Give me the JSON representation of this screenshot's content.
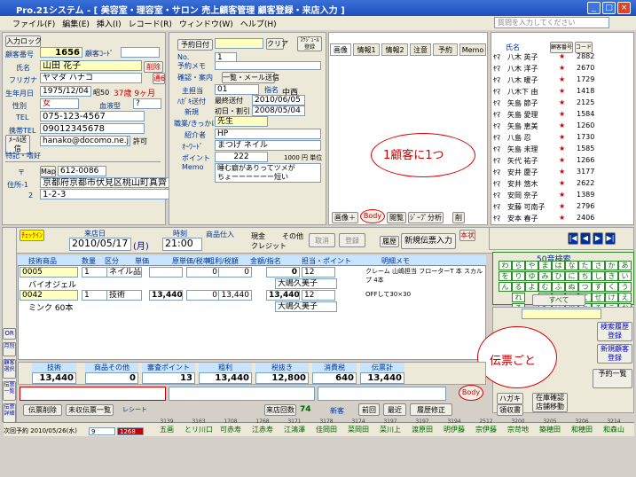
{
  "window": {
    "title": "Pro.21システム - [ 美容室・理容室・サロン 売上顧客管理 顧客登録・来店入力 ]",
    "help_placeholder": "質問を入力してください"
  },
  "menu": [
    "ファイル(F)",
    "編集(E)",
    "挿入(I)",
    "レコード(R)",
    "ウィンドウ(W)",
    "ヘルプ(H)"
  ],
  "customer": {
    "input_lock": "入力ロック",
    "no_label": "顧客番号",
    "no": "1656",
    "code_label": "顧客ｺｰﾄﾞ",
    "name_label": "氏名",
    "name": "山田 花子",
    "delete": "削除",
    "furigana_label": "フリガナ",
    "furigana": "ヤマダ ハナコ",
    "tsu": "通6",
    "birth_label": "生年月日",
    "birth": "1975/12/04",
    "era": "昭50",
    "age": "37",
    "age_unit": "歳",
    "months": "9",
    "month_unit": "ヶ月",
    "sex_label": "性別",
    "sex": "女",
    "blood_label": "血液型",
    "blood": "?",
    "tel_label": "TEL",
    "tel": "075-123-4567",
    "mobile_label": "携帯TEL",
    "mobile": "09012345678",
    "mail_btn": "ﾒｰﾙ送信",
    "mail": "hanako@docomo.ne.jp",
    "permit": "許可",
    "feature_label": "特記・嗜好",
    "zip_label": "〒",
    "map": "Map",
    "zip": "612-0086",
    "addr_label": "住所-1",
    "addr1": "京都府京都市伏見区桃山町真齊",
    "addr2_label": "2",
    "addr2": "1-2-3"
  },
  "middle": {
    "yoyaku": "予約日付",
    "clip": "クリア",
    "schedule": "ｽｹｼﾞｭｰﾙ登録",
    "no_label": "No.",
    "no": "1",
    "memo_label": "予約メモ",
    "mail_send": "一覧・メール送信",
    "confirm_label": "確認・案内",
    "staff_label": "主担当",
    "staff": "01",
    "shimei": "指名",
    "chuuken": "中西",
    "hagaki_label": "ﾊｶﾞｷ送付",
    "hagaki_check": "最終送付",
    "hagaki_date": "2010/06/05",
    "new_label": "新規",
    "first_label": "初日・割引",
    "first_date": "2008/05/04",
    "job_label": "職業/きっかけ",
    "job": "先生",
    "intro_label": "紹介者",
    "intro": "HP",
    "word_label": "ｵｰﾜｰﾄﾞ",
    "word": "まつげ ネイル",
    "point_label": "ポイント",
    "point": "222",
    "point_unit": "1000 円 単位",
    "memo2_label": "Memo",
    "memo2": "睡む癖がありってツメが\nちょーーーーーー短い"
  },
  "tabs": [
    "画像",
    "情報1",
    "情報2",
    "注意",
    "予約",
    "Memo"
  ],
  "image_btns": [
    "画像＋",
    "Body",
    "閲覧",
    "ｼﾞｰﾌﾟ分析",
    "削"
  ],
  "annotation1": "1顧客に1つ",
  "annotation2": "伝票ごと",
  "customer_list": {
    "header": [
      "氏名",
      "顧客番号",
      "コード"
    ],
    "rows": [
      [
        "ﾔﾏ",
        "八木 英子",
        "2882"
      ],
      [
        "ﾔﾏ",
        "八木 洋子",
        "2670"
      ],
      [
        "ﾔﾏ",
        "八木 暖子",
        "1729"
      ],
      [
        "ﾔﾏ",
        "八木下 由",
        "1418"
      ],
      [
        "ﾔﾏ",
        "矢島 節子",
        "2125"
      ],
      [
        "ﾔﾏ",
        "矢島 愛理",
        "1584"
      ],
      [
        "ﾔﾏ",
        "矢島 恵美",
        "1260"
      ],
      [
        "ﾔﾏ",
        "八島 忍",
        "1730"
      ],
      [
        "ﾔﾏ",
        "矢島 未理",
        "1585"
      ],
      [
        "ﾔﾏ",
        "矢代 祐子",
        "1266"
      ],
      [
        "ﾔﾏ",
        "安井 慶子",
        "3177"
      ],
      [
        "ﾔﾏ",
        "安井 悠木",
        "2622"
      ],
      [
        "ﾔﾏ",
        "安岡 奈子",
        "1389"
      ],
      [
        "ﾔﾏ",
        "安藤 可南子",
        "2796"
      ],
      [
        "ﾔﾏ",
        "安本 春子",
        "2406"
      ]
    ]
  },
  "visit": {
    "label": "ﾁｪｯｸｲﾝ",
    "date_label": "来店日",
    "date": "2010/05/17",
    "dow": "(月)",
    "time_label": "時刻",
    "time": "21:00",
    "goods_label": "商品仕入",
    "pay_cash": "現金",
    "pay_credit": "クレジット",
    "pay_other": "その他",
    "cancel": "取消",
    "register": "登録",
    "history": "履歴",
    "new_slip": "新規伝票入力",
    "lock": "本状"
  },
  "grid_header": [
    "技術商品",
    "数量",
    "区分",
    "単価",
    "原単価/税率",
    "粗利/税額",
    "金額/指名",
    "担当・ポイント",
    "明細メモ"
  ],
  "grid_rows": [
    {
      "code": "0005",
      "qty": "1",
      "kind": "ネイル品",
      "price": "",
      "cost": "0",
      "profit": "0",
      "amount": "0",
      "pt": "12",
      "memo": "クレーム 山嶋担当 フローターT 本 スカルプ 4本",
      "name": "バイオジェル",
      "staff": "大嶋久美子"
    },
    {
      "code": "0042",
      "qty": "1",
      "kind": "技術",
      "price": "13,440",
      "cost": "0",
      "profit": "13,440",
      "amount": "13,440",
      "pt": "12",
      "memo": "OFFして30×30",
      "name": "ミンク 60本",
      "staff": "大嶋久美子"
    }
  ],
  "totals": {
    "tech_label": "技術",
    "tech": "13,440",
    "goods_label": "商品その他",
    "goods": "0",
    "point_label": "審査ポイント",
    "point": "13",
    "arari_label": "粗利",
    "arari": "13,440",
    "tax_ex_label": "税抜き",
    "tax_ex": "12,800",
    "tax_label": "消費税",
    "tax": "640",
    "total_label": "伝票計",
    "total": "13,440"
  },
  "bottom": {
    "slip_delete": "伝票削除",
    "slip_list": "未収伝票一覧",
    "receipt": "レシート",
    "visits_label": "来店回数",
    "visits": "74",
    "new_label": "新客",
    "prev": "前回",
    "latest": "最近",
    "history_edit": "履歴修正",
    "next_visit": "次回予約 2010/05/26(水)",
    "cycle": "9",
    "total_sales": "1268"
  },
  "bottom_staff": [
    [
      "3139",
      "五画"
    ],
    [
      "3163",
      "とリ川口"
    ],
    [
      "1708",
      "可赤寿"
    ],
    [
      "1768",
      "江赤寿"
    ],
    [
      "3171",
      "江鴻澤"
    ],
    [
      "3178",
      "佳岡田"
    ],
    [
      "3174",
      "菜岡田"
    ],
    [
      "3197",
      "菜川上"
    ],
    [
      "3197",
      "渡原田"
    ],
    [
      "3194",
      "明伊藤"
    ],
    [
      "2512",
      "宗伊藤"
    ],
    [
      "3200",
      "宗苛地"
    ],
    [
      "3205",
      "築穂田"
    ],
    [
      "3206",
      "和穂田"
    ],
    [
      "3214",
      "和森山"
    ]
  ],
  "kana_search": "50音検索",
  "kana": [
    [
      "わ",
      "ら",
      "や",
      "ま",
      "は",
      "な",
      "た",
      "さ",
      "か",
      "あ"
    ],
    [
      "を",
      "り",
      "ゆ",
      "み",
      "ひ",
      "に",
      "ち",
      "し",
      "き",
      "い"
    ],
    [
      "ん",
      "る",
      "よ",
      "む",
      "ふ",
      "ぬ",
      "つ",
      "す",
      "く",
      "う"
    ],
    [
      "",
      "れ",
      "",
      "め",
      "へ",
      "ね",
      "て",
      "せ",
      "け",
      "え"
    ],
    [
      "",
      "ろ",
      "",
      "も",
      "ほ",
      "の",
      "と",
      "そ",
      "こ",
      "お"
    ]
  ],
  "kana_all": "すべて",
  "right_buttons": [
    "検索履歴登録",
    "新規顧客登録",
    "ハガキ",
    "領収書",
    "在庫確認店舗移動",
    "予約一覧"
  ],
  "left_side": [
    "OR",
    "月別",
    "顧客選択",
    "伝票一覧",
    "伝票詳細",
    "売上"
  ],
  "small_btns": [
    "ﾚｼﾞ",
    "印刷",
    "精算",
    "ﾚｼﾞﾄﾚｲ",
    "集計",
    "実付"
  ]
}
